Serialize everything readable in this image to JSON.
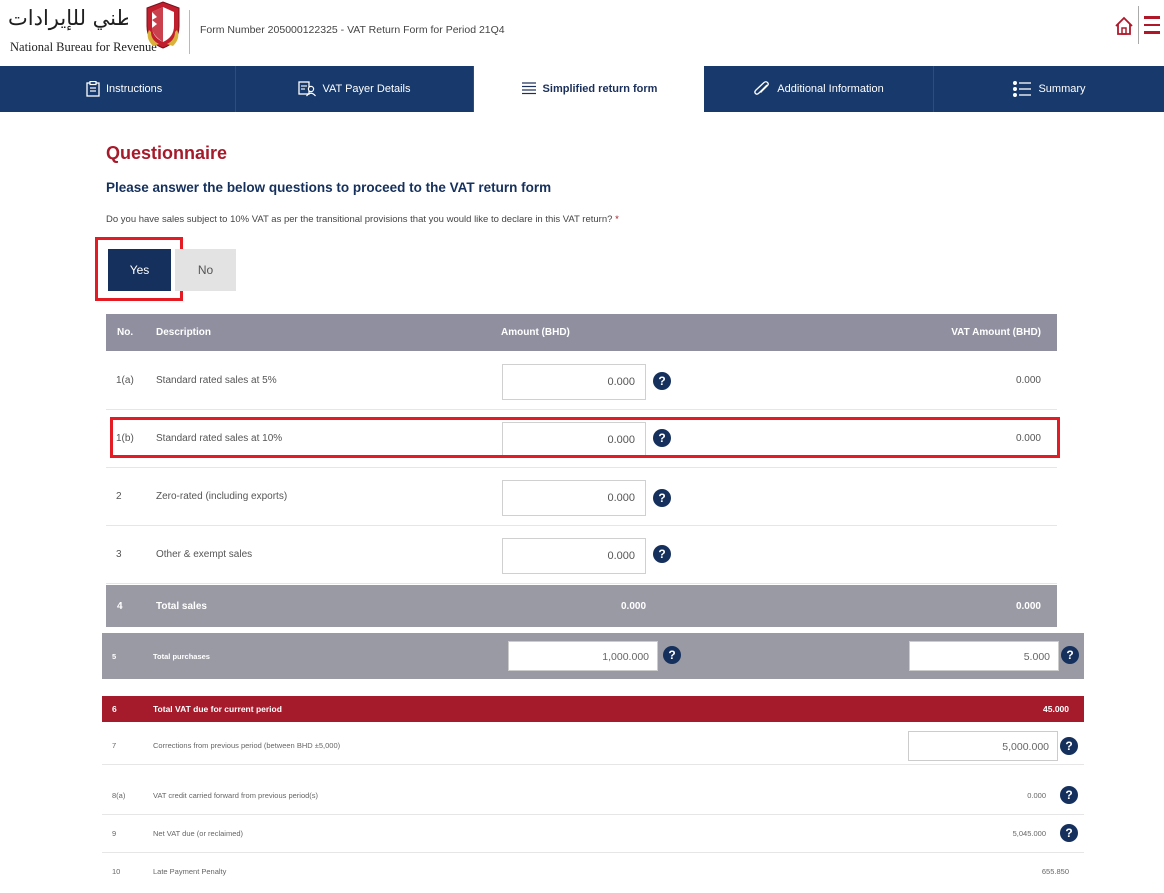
{
  "header": {
    "logo_arabic": "الجهاز الوطني للإيرادات",
    "logo_english": "National Bureau for Revenue",
    "form_title": "Form Number 205000122325 - VAT Return Form for Period 21Q4",
    "icons": [
      "home-icon",
      "menu-icon"
    ]
  },
  "tabs": [
    {
      "label": "Instructions",
      "icon": "clipboard-icon",
      "active": false
    },
    {
      "label": "VAT Payer Details",
      "icon": "id-card-icon",
      "active": false
    },
    {
      "label": "Simplified return form",
      "icon": "list-icon",
      "active": true
    },
    {
      "label": "Additional Information",
      "icon": "paperclip-icon",
      "active": false
    },
    {
      "label": "Summary",
      "icon": "checklist-icon",
      "active": false
    }
  ],
  "questionnaire": {
    "title": "Questionnaire",
    "subtitle": "Please answer the below questions to proceed to the VAT return form",
    "question": "Do you have sales subject to 10% VAT as per the transitional provisions that you would like to declare in this VAT return?",
    "required_mark": "*",
    "yes_label": "Yes",
    "no_label": "No",
    "selected": "Yes"
  },
  "table": {
    "headers": {
      "no": "No.",
      "description": "Description",
      "amount": "Amount (BHD)",
      "vat": "VAT Amount (BHD)"
    },
    "rows": [
      {
        "no": "1(a)",
        "description": "Standard rated sales at 5%",
        "amount": "0.000",
        "vat": "0.000"
      },
      {
        "no": "1(b)",
        "description": "Standard rated sales at 10%",
        "amount": "0.000",
        "vat": "0.000"
      },
      {
        "no": "2",
        "description": "Zero-rated (including exports)",
        "amount": "0.000",
        "vat": ""
      },
      {
        "no": "3",
        "description": "Other & exempt sales",
        "amount": "0.000",
        "vat": ""
      }
    ],
    "total_sales": {
      "no": "4",
      "description": "Total sales",
      "amount": "0.000",
      "vat": "0.000"
    },
    "total_purchases": {
      "no": "5",
      "description": "Total purchases",
      "amount": "1,000.000",
      "vat": "5.000"
    },
    "vat_due": {
      "no": "6",
      "description": "Total VAT due for current period",
      "value": "45.000"
    },
    "extra_rows": [
      {
        "no": "7",
        "description": "Corrections from previous period (between BHD ±5,000)",
        "value": "5,000.000"
      },
      {
        "no": "8(a)",
        "description": "VAT credit carried forward from previous period(s)",
        "value": "0.000"
      },
      {
        "no": "9",
        "description": "Net VAT due (or reclaimed)",
        "value": "5,045.000"
      },
      {
        "no": "10",
        "description": "Late Payment Penalty",
        "value": "655.850"
      }
    ],
    "help_glyph": "?"
  },
  "colors": {
    "navy": "#15305c",
    "tab_bar": "#17396c",
    "brand_red": "#a61b2b",
    "highlight_red": "#e41b22",
    "header_gray": "#8f8f9f"
  }
}
